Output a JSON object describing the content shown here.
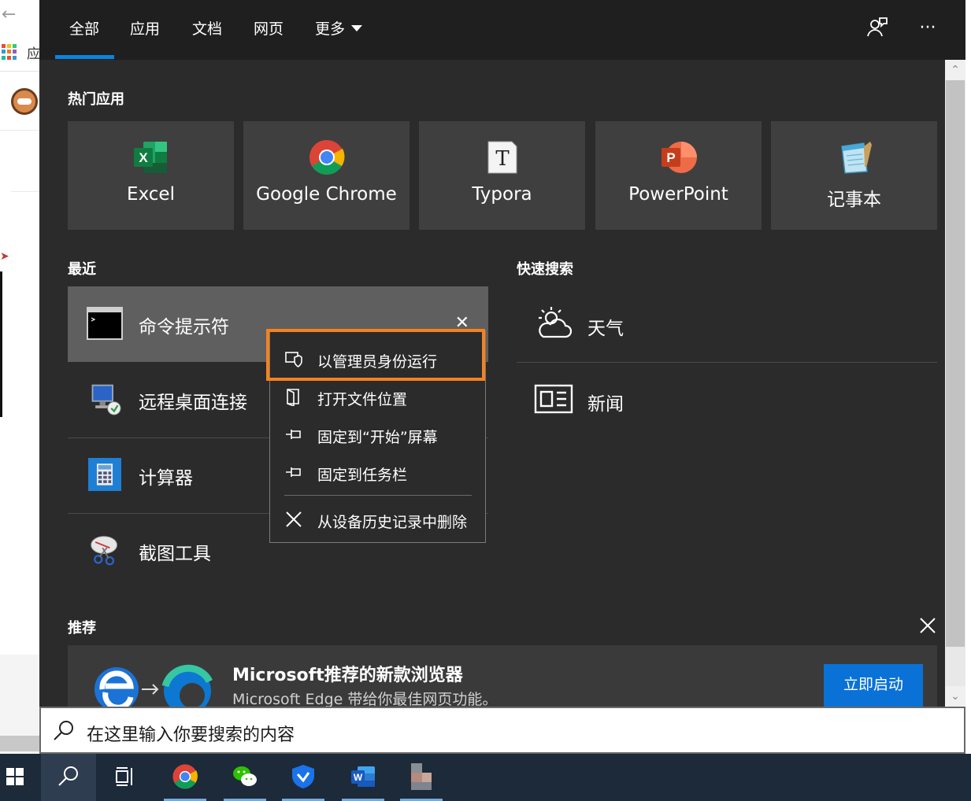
{
  "background": {
    "apps_label": "应"
  },
  "header": {
    "tabs": [
      {
        "label": "全部"
      },
      {
        "label": "应用"
      },
      {
        "label": "文档"
      },
      {
        "label": "网页"
      },
      {
        "label": "更多"
      }
    ],
    "icons": [
      "feedback-icon",
      "more-options-icon"
    ]
  },
  "top_apps": {
    "title": "热门应用",
    "items": [
      {
        "label": "Excel",
        "icon": "excel-icon"
      },
      {
        "label": "Google Chrome",
        "icon": "chrome-icon"
      },
      {
        "label": "Typora",
        "icon": "typora-icon"
      },
      {
        "label": "PowerPoint",
        "icon": "powerpoint-icon"
      },
      {
        "label": "记事本",
        "icon": "notepad-icon"
      }
    ]
  },
  "recent": {
    "title": "最近",
    "items": [
      {
        "label": "命令提示符",
        "icon": "cmd-icon"
      },
      {
        "label": "远程桌面连接",
        "icon": "remote-desktop-icon"
      },
      {
        "label": "计算器",
        "icon": "calculator-icon"
      },
      {
        "label": "截图工具",
        "icon": "snipping-tool-icon"
      }
    ]
  },
  "quick_search": {
    "title": "快速搜索",
    "items": [
      {
        "label": "天气",
        "icon": "weather-icon"
      },
      {
        "label": "新闻",
        "icon": "news-icon"
      }
    ]
  },
  "context_menu": {
    "items": [
      {
        "label": "以管理员身份运行",
        "icon": "admin-shield-icon"
      },
      {
        "label": "打开文件位置",
        "icon": "file-location-icon"
      },
      {
        "label": "固定到“开始”屏幕",
        "icon": "pin-icon"
      },
      {
        "label": "固定到任务栏",
        "icon": "pin-icon"
      },
      {
        "label": "从设备历史记录中删除",
        "icon": "close-icon"
      }
    ]
  },
  "recommend": {
    "title": "推荐",
    "card_title": "Microsoft推荐的新款浏览器",
    "card_desc": "Microsoft Edge 带给你最佳网页功能。",
    "button": "立即启动"
  },
  "search": {
    "placeholder": "在这里输入你要搜索的内容"
  },
  "taskbar": {
    "items": [
      "windows-start-icon",
      "search-icon",
      "task-view-icon",
      "chrome-icon",
      "wechat-icon",
      "security-app-icon",
      "word-icon",
      "blurred-app-icon"
    ]
  },
  "colors": {
    "accent": "#0a84e0",
    "highlight": "#f5821f",
    "panel": "#2b2b2b"
  }
}
